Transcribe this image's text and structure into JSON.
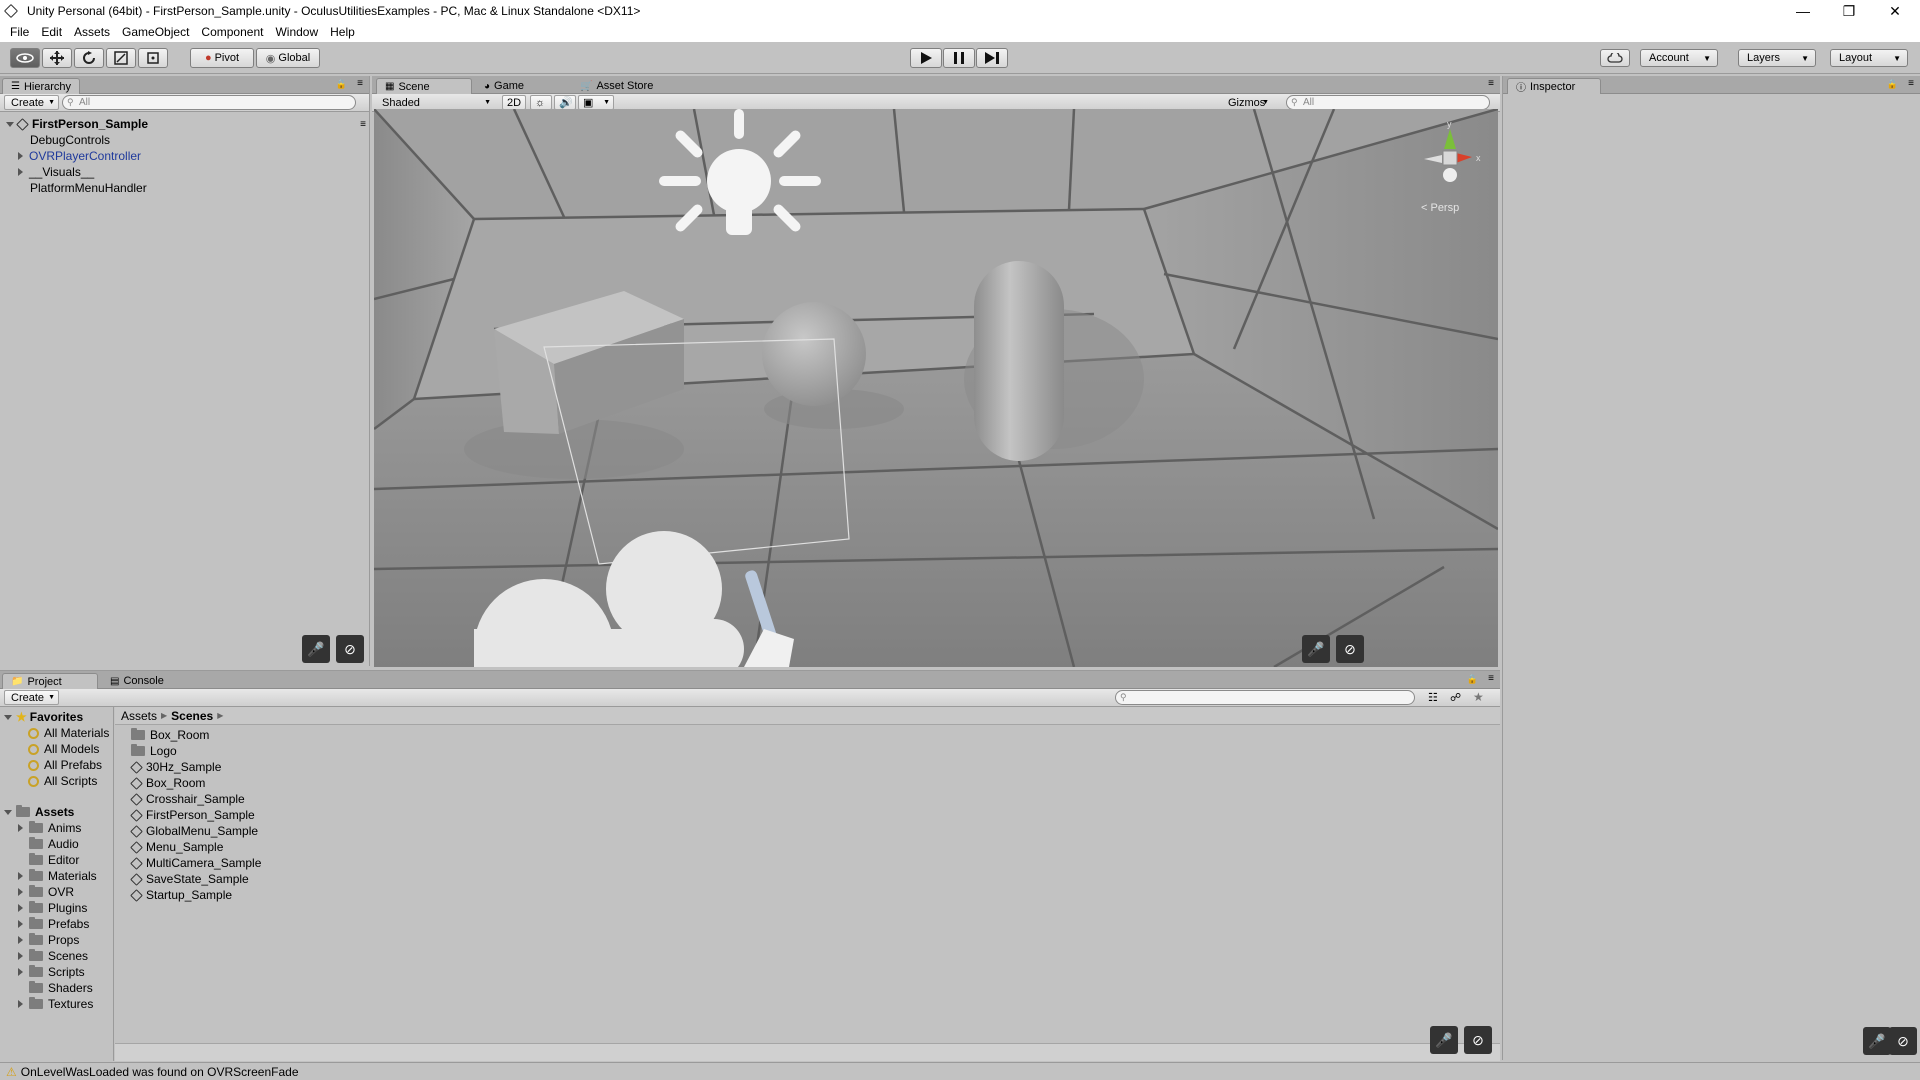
{
  "window": {
    "title": "Unity Personal (64bit) - FirstPerson_Sample.unity - OculusUtilitiesExamples - PC, Mac & Linux Standalone <DX11>"
  },
  "menu": [
    "File",
    "Edit",
    "Assets",
    "GameObject",
    "Component",
    "Window",
    "Help"
  ],
  "toolbar": {
    "pivot": "Pivot",
    "global": "Global",
    "account": "Account",
    "layers": "Layers",
    "layout": "Layout"
  },
  "hierarchy": {
    "tab": "Hierarchy",
    "create": "Create",
    "search_placeholder": "All",
    "scene": "FirstPerson_Sample",
    "items": [
      {
        "label": "DebugControls",
        "expandable": false
      },
      {
        "label": "OVRPlayerController",
        "expandable": true,
        "prefab": true
      },
      {
        "label": "__Visuals__",
        "expandable": true
      },
      {
        "label": "PlatformMenuHandler",
        "expandable": false
      }
    ]
  },
  "scene": {
    "tabs": [
      "Scene",
      "Game",
      "Asset Store"
    ],
    "shading": "Shaded",
    "mode2d": "2D",
    "gizmos": "Gizmos",
    "search_placeholder": "All",
    "persp": "< Persp",
    "axes": {
      "x": "x",
      "y": "y"
    }
  },
  "inspector": {
    "tab": "Inspector"
  },
  "project": {
    "tabs": [
      "Project",
      "Console"
    ],
    "create": "Create",
    "favorites_label": "Favorites",
    "favorites": [
      "All Materials",
      "All Models",
      "All Prefabs",
      "All Scripts"
    ],
    "assets_label": "Assets",
    "asset_folders": [
      {
        "label": "Anims",
        "expandable": true
      },
      {
        "label": "Audio",
        "expandable": false
      },
      {
        "label": "Editor",
        "expandable": false
      },
      {
        "label": "Materials",
        "expandable": true
      },
      {
        "label": "OVR",
        "expandable": true
      },
      {
        "label": "Plugins",
        "expandable": true
      },
      {
        "label": "Prefabs",
        "expandable": true
      },
      {
        "label": "Props",
        "expandable": true
      },
      {
        "label": "Scenes",
        "expandable": true
      },
      {
        "label": "Scripts",
        "expandable": true
      },
      {
        "label": "Shaders",
        "expandable": false
      },
      {
        "label": "Textures",
        "expandable": true
      }
    ],
    "breadcrumb": [
      "Assets",
      "Scenes"
    ],
    "files": [
      {
        "label": "Box_Room",
        "type": "folder"
      },
      {
        "label": "Logo",
        "type": "folder"
      },
      {
        "label": "30Hz_Sample",
        "type": "scene"
      },
      {
        "label": "Box_Room",
        "type": "scene"
      },
      {
        "label": "Crosshair_Sample",
        "type": "scene"
      },
      {
        "label": "FirstPerson_Sample",
        "type": "scene"
      },
      {
        "label": "GlobalMenu_Sample",
        "type": "scene"
      },
      {
        "label": "Menu_Sample",
        "type": "scene"
      },
      {
        "label": "MultiCamera_Sample",
        "type": "scene"
      },
      {
        "label": "SaveState_Sample",
        "type": "scene"
      },
      {
        "label": "Startup_Sample",
        "type": "scene"
      }
    ]
  },
  "status": {
    "message": "OnLevelWasLoaded was found on OVRScreenFade"
  }
}
